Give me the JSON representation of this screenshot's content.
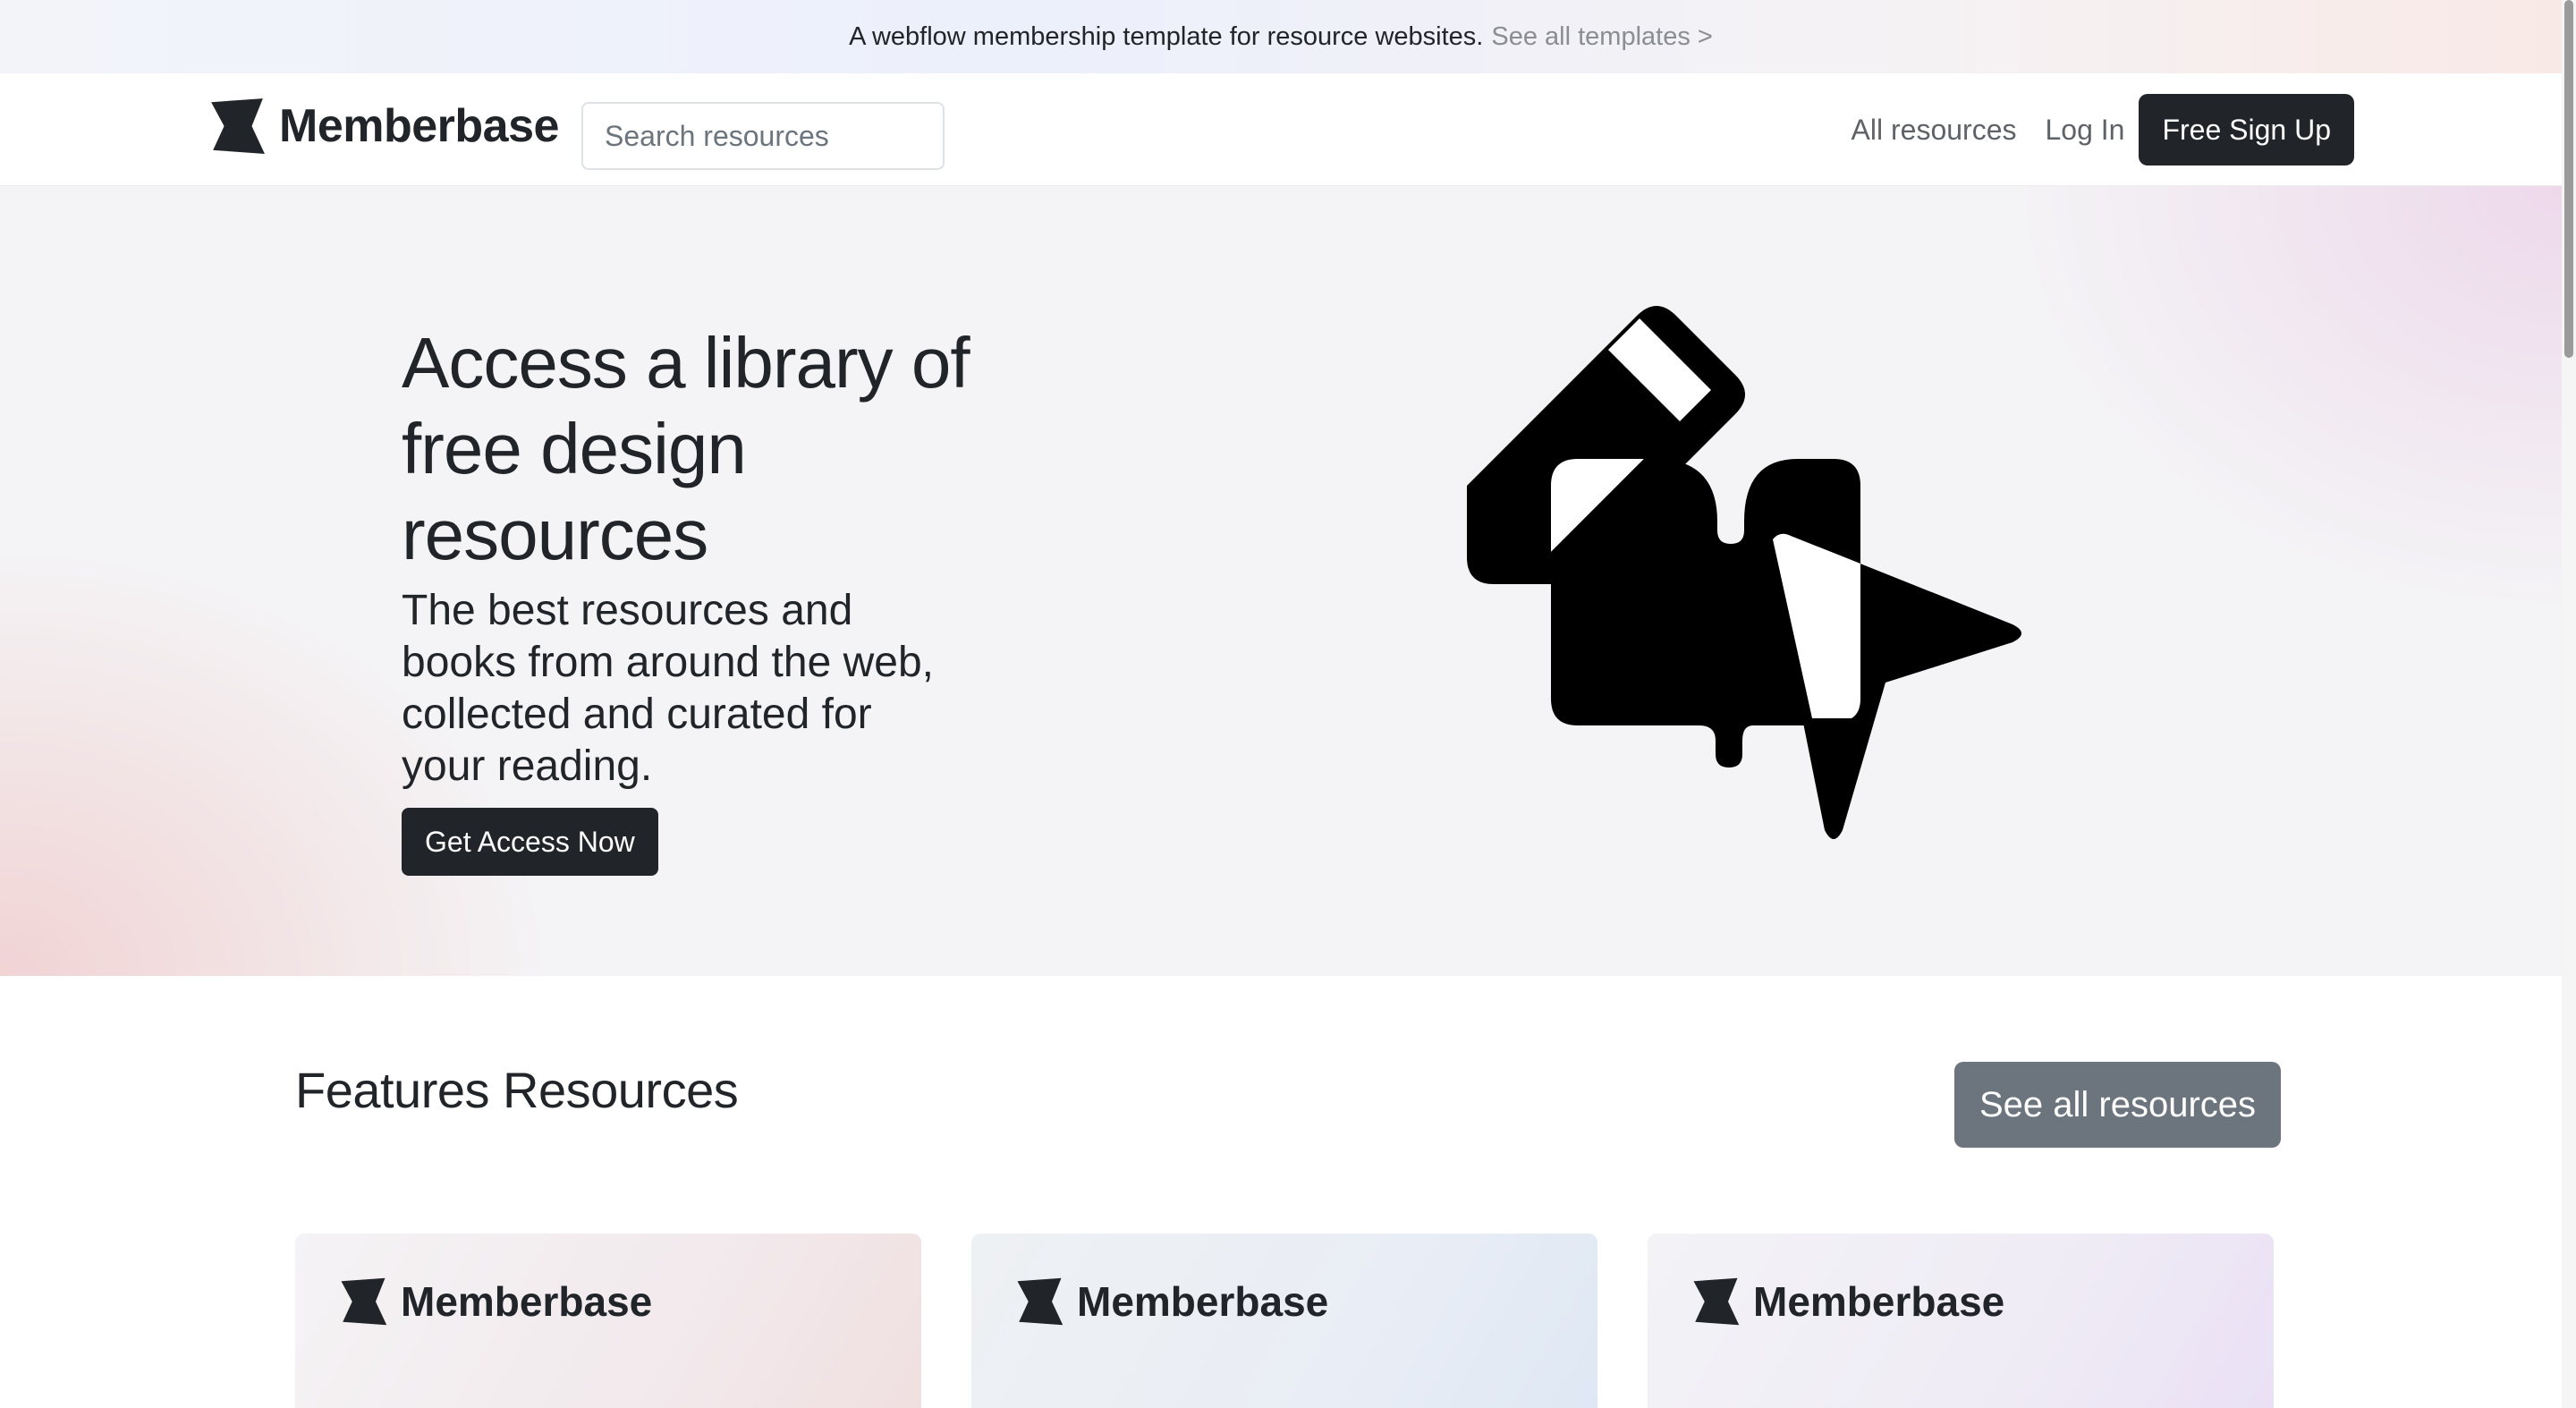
{
  "announcement": {
    "message": "A webflow membership template for resource websites.",
    "link_label": "See all templates >"
  },
  "navbar": {
    "brand_name": "Memberbase",
    "brand_icon": "memberbase-logo-icon",
    "search_placeholder": "Search resources",
    "links": [
      "All resources",
      "Log In"
    ],
    "signup_label": "Free Sign Up"
  },
  "hero": {
    "title": "Access a library of free design resources",
    "subtitle": "The best resources and books from around the web, collected and curated for your reading.",
    "cta_label": "Get Access Now",
    "illustration_icon": "pencil-chat-cursor-illustration"
  },
  "features": {
    "title": "Features Resources",
    "see_all_label": "See all resources",
    "cards": [
      {
        "brand": "Memberbase"
      },
      {
        "brand": "Memberbase"
      },
      {
        "brand": "Memberbase"
      }
    ]
  },
  "colors": {
    "primary_dark": "#212529",
    "secondary": "#6c757d",
    "muted_link": "#8a8d91"
  }
}
